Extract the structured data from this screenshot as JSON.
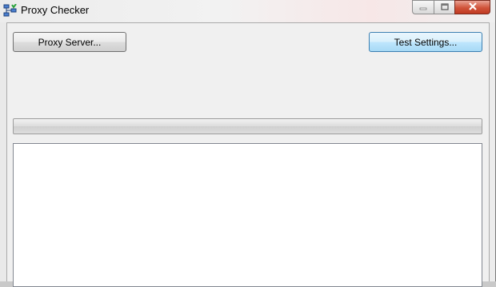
{
  "window": {
    "title": "Proxy Checker",
    "icon": "proxy-network-icon",
    "controls": {
      "minimize_icon": "minimize-icon",
      "maximize_icon": "maximize-icon",
      "close_icon": "close-icon"
    }
  },
  "toolbar": {
    "proxy_server_label": "Proxy Server...",
    "test_settings_label": "Test Settings..."
  },
  "progress": {
    "value": 0
  },
  "log": {
    "text": ""
  },
  "colors": {
    "close_button": "#c8432b",
    "focused_button_border": "#3c7fb1",
    "client_background": "#f0f0f0"
  }
}
